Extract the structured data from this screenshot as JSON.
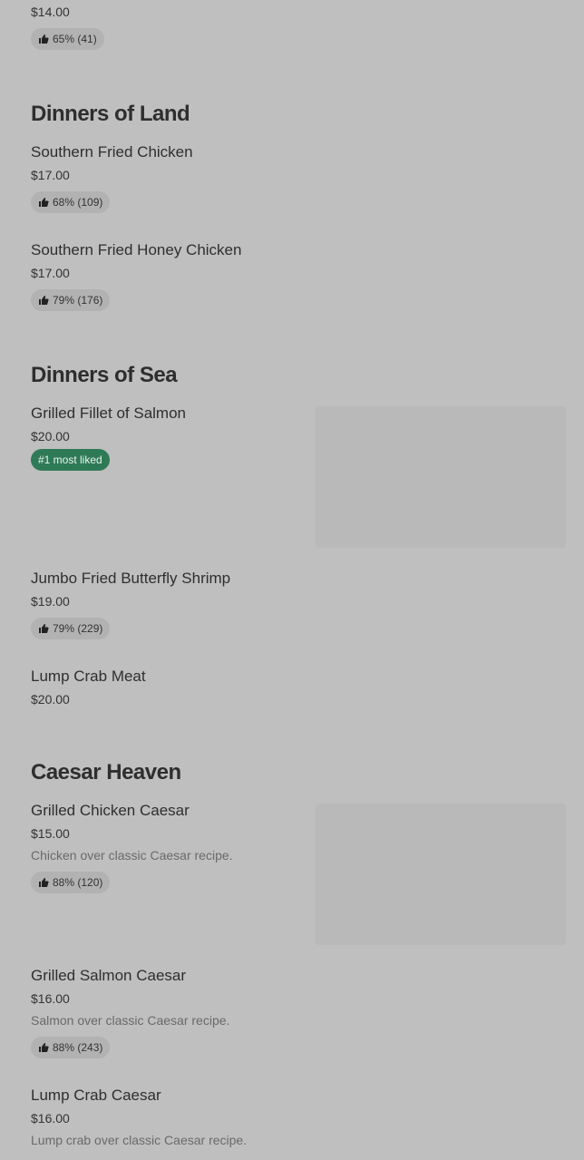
{
  "top_item": {
    "price": "$14.00",
    "rating": "65% (41)"
  },
  "sections": {
    "land": {
      "title": "Dinners of Land",
      "items": [
        {
          "name": "Southern Fried Chicken",
          "price": "$17.00",
          "rating": "68% (109)"
        },
        {
          "name": "Southern Fried Honey Chicken",
          "price": "$17.00",
          "rating": "79% (176)"
        }
      ]
    },
    "sea": {
      "title": "Dinners of Sea",
      "items": [
        {
          "name": "Grilled Fillet of Salmon",
          "price": "$20.00",
          "badge": "#1 most liked"
        },
        {
          "name": "Jumbo Fried Butterfly Shrimp",
          "price": "$19.00",
          "rating": "79% (229)"
        },
        {
          "name": "Lump Crab Meat",
          "price": "$20.00"
        }
      ]
    },
    "caesar": {
      "title": "Caesar Heaven",
      "items": [
        {
          "name": "Grilled Chicken Caesar",
          "price": "$15.00",
          "description": "Chicken over classic Caesar recipe.",
          "rating": "88% (120)"
        },
        {
          "name": "Grilled Salmon Caesar",
          "price": "$16.00",
          "description": "Salmon over classic Caesar recipe.",
          "rating": "88% (243)"
        },
        {
          "name": "Lump Crab Caesar",
          "price": "$16.00",
          "description": "Lump crab over classic Caesar recipe."
        }
      ]
    }
  },
  "icons": {
    "thumbs_up": "thumbs-up-icon"
  },
  "colors": {
    "background": "#bfbfbf",
    "liked_badge": "#2f7a56",
    "rating_badge": "#b2b2b2"
  }
}
